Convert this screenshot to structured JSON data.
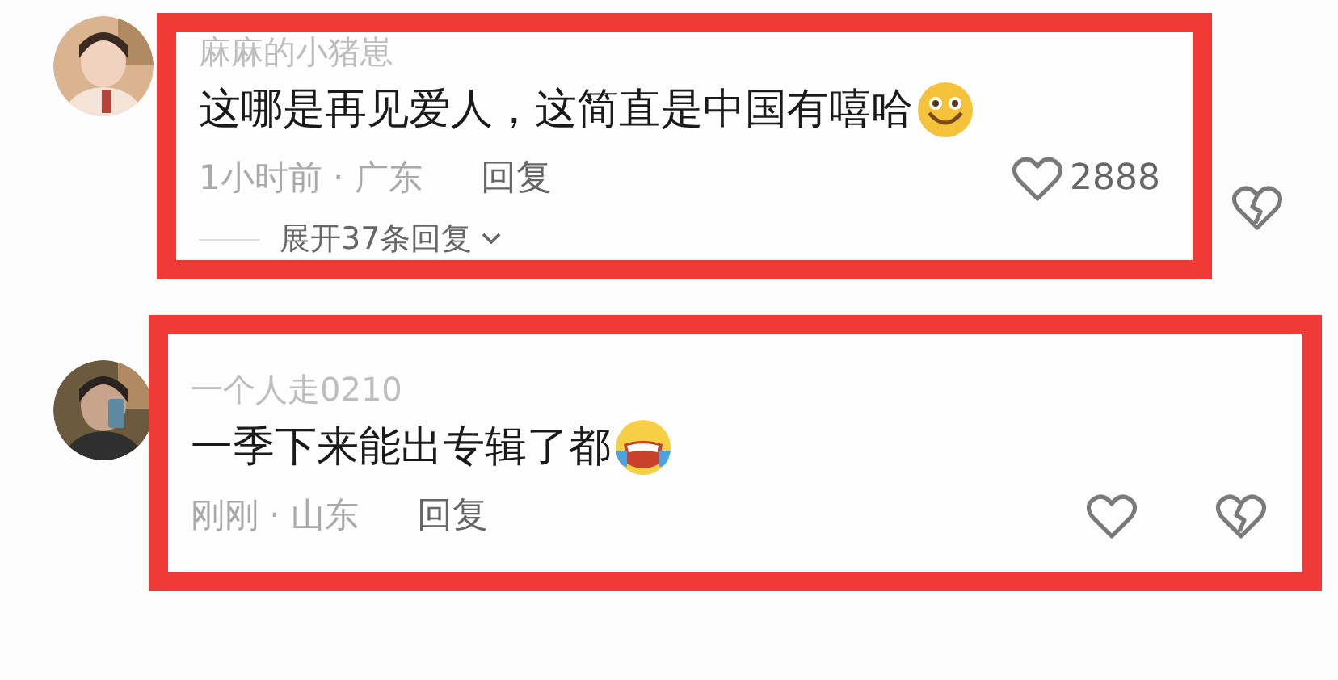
{
  "comments": [
    {
      "username": "麻麻的小猪崽",
      "text": "这哪是再见爱人，这简直是中国有嘻哈",
      "emoji": {
        "kind": "smile"
      },
      "meta": "1小时前 · 广东",
      "reply": "回复",
      "likes": "2888",
      "expand": "展开37条回复",
      "highlight_includes_dislike": false
    },
    {
      "username": "一个人走0210",
      "text": "一季下来能出专辑了都",
      "emoji": {
        "kind": "laugh-cry"
      },
      "meta": "刚刚 · 山东",
      "reply": "回复",
      "highlight_includes_dislike": true
    }
  ]
}
